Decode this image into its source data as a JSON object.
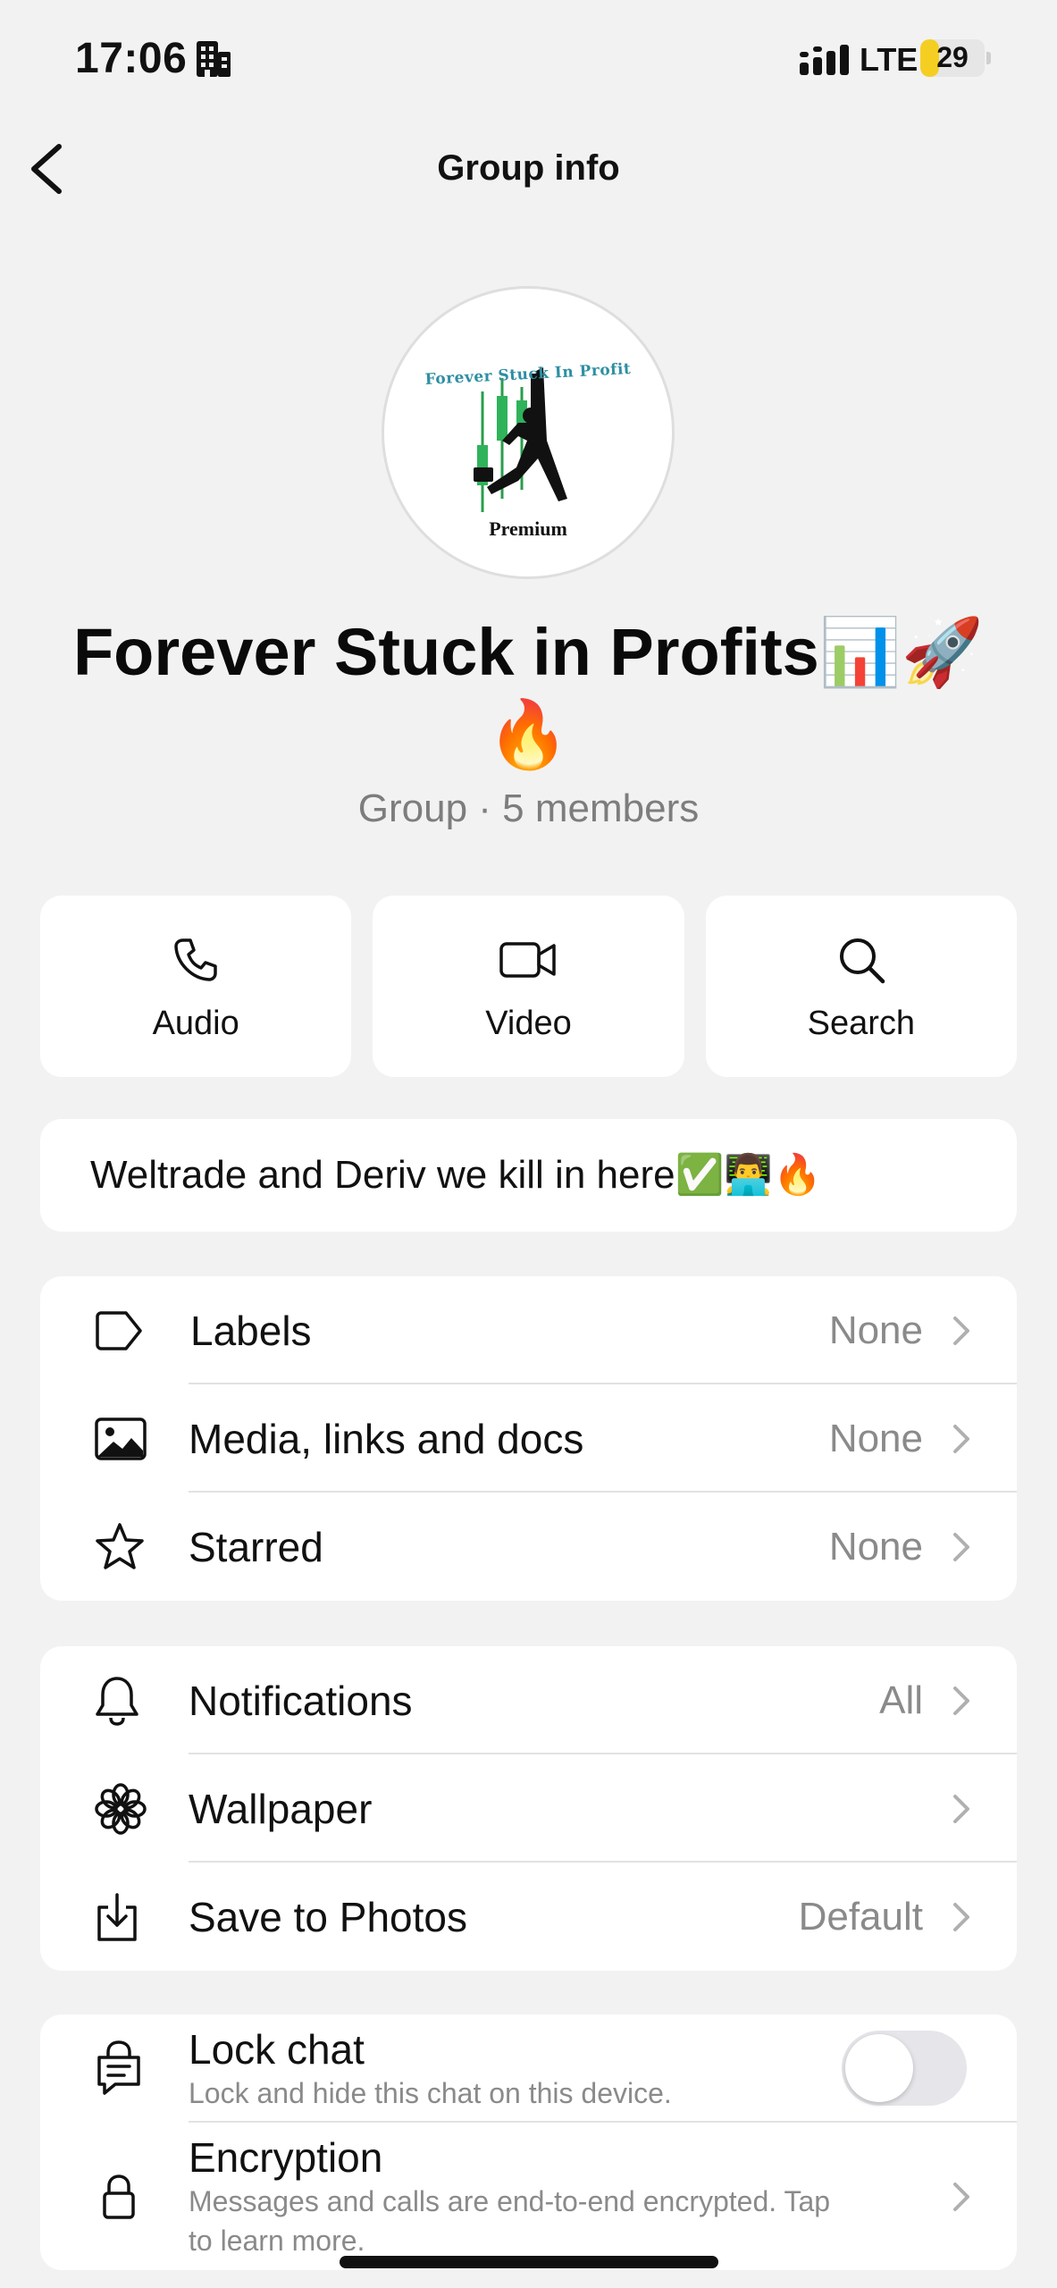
{
  "status_bar": {
    "time": "17:06",
    "network": "LTE",
    "battery": "29",
    "battery_color": "#f4cf22"
  },
  "nav": {
    "back_icon": "chevron-left-icon",
    "title": "Group info"
  },
  "avatar": {
    "top_text": "Forever Stuck In Profit",
    "bottom_text": "Premium"
  },
  "group": {
    "name": "Forever Stuck in Profits📊🚀🔥",
    "meta": "Group · 5 members"
  },
  "actions": [
    {
      "label": "Audio",
      "icon": "phone-icon"
    },
    {
      "label": "Video",
      "icon": "video-icon"
    },
    {
      "label": "Search",
      "icon": "search-icon"
    }
  ],
  "description": "Weltrade and Deriv we kill in here✅👨‍💻🔥",
  "section1": [
    {
      "label": "Labels",
      "value": "None",
      "icon": "label-icon"
    },
    {
      "label": "Media, links and docs",
      "value": "None",
      "icon": "image-icon"
    },
    {
      "label": "Starred",
      "value": "None",
      "icon": "star-icon"
    }
  ],
  "section2": [
    {
      "label": "Notifications",
      "value": "All",
      "icon": "bell-icon"
    },
    {
      "label": "Wallpaper",
      "value": "",
      "icon": "flower-icon"
    },
    {
      "label": "Save to Photos",
      "value": "Default",
      "icon": "download-icon"
    }
  ],
  "section3": {
    "lock": {
      "label": "Lock chat",
      "sub": "Lock and hide this chat on this device.",
      "enabled": false
    },
    "encryption": {
      "label": "Encryption",
      "sub1": "Messages and calls are end-to-end encrypted. Tap",
      "sub2": "to learn more."
    }
  }
}
